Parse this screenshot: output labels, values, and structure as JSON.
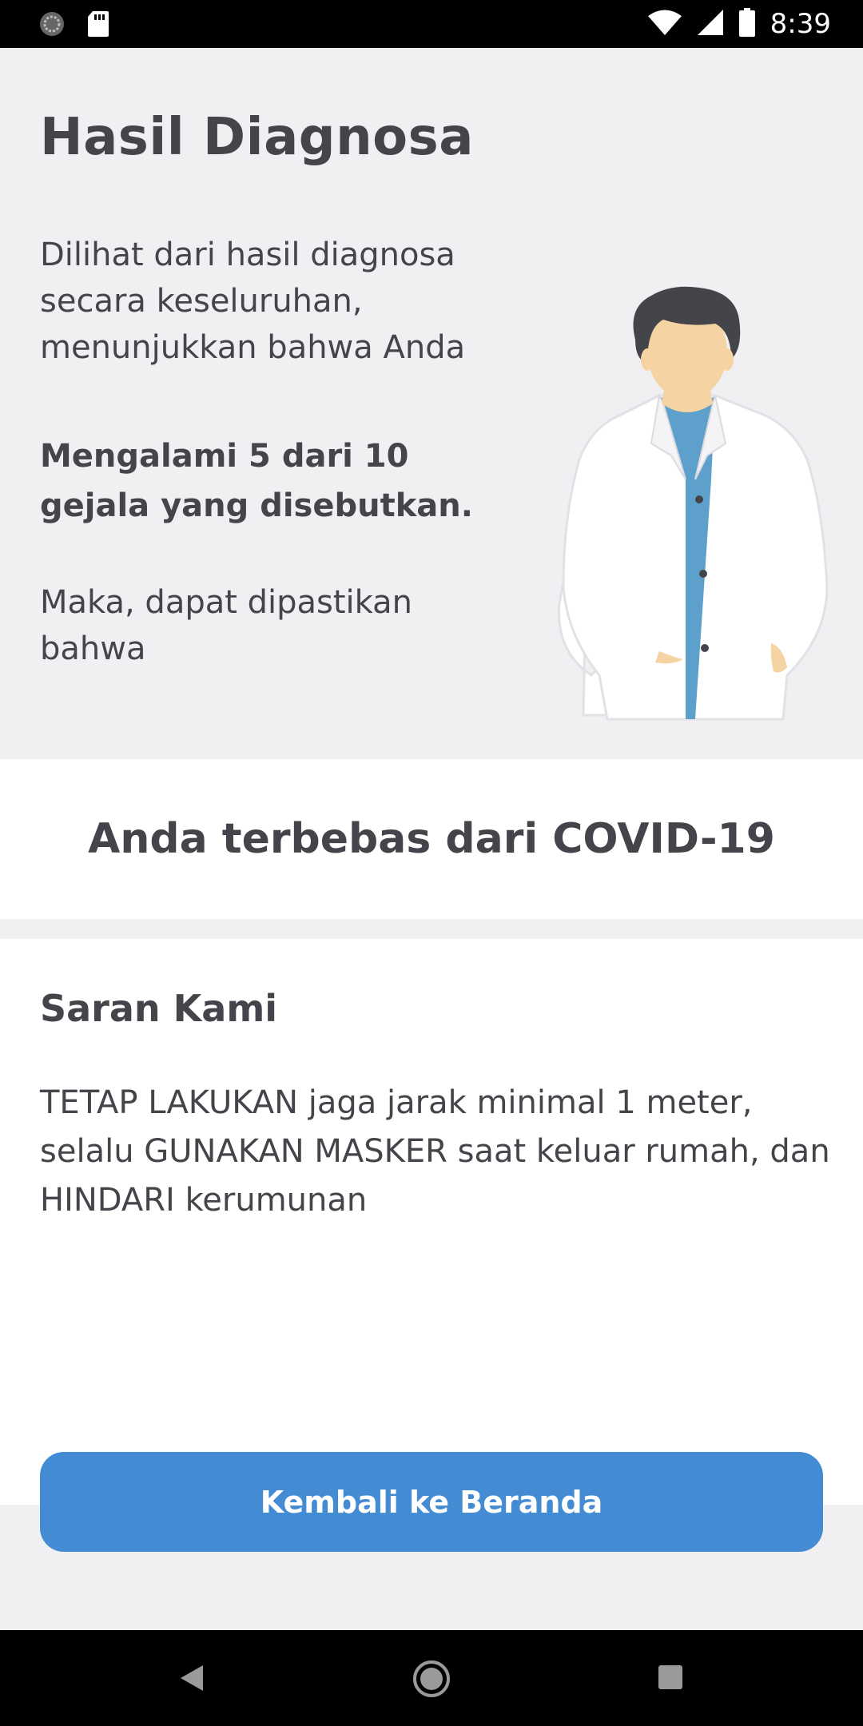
{
  "status_bar": {
    "time": "8:39",
    "icons": [
      "notification-circle-icon",
      "sd-card-icon",
      "wifi-icon",
      "signal-icon",
      "battery-icon"
    ]
  },
  "header": {
    "title": "Hasil Diagnosa",
    "intro": "Dilihat dari hasil diagnosa secara keseluruhan, menunjukkan bahwa Anda",
    "symptoms": "Mengalami 5 dari 10 gejala yang disebutkan.",
    "conclusion_lead": "Maka, dapat dipastikan bahwa",
    "illustration": "doctor-illustration"
  },
  "result": {
    "text": "Anda terbebas dari COVID-19"
  },
  "advice": {
    "title": "Saran Kami",
    "body": "TETAP LAKUKAN jaga jarak minimal 1 meter, selalu GUNAKAN MASKER saat keluar rumah, dan HINDARI kerumunan"
  },
  "actions": {
    "home_button_label": "Kembali ke Beranda"
  },
  "nav_bar": {
    "icons": [
      "back-icon",
      "home-icon",
      "recents-icon"
    ]
  },
  "colors": {
    "accent": "#438bd3",
    "text": "#44454a",
    "background": "#f0f0f2",
    "card": "#ffffff"
  }
}
